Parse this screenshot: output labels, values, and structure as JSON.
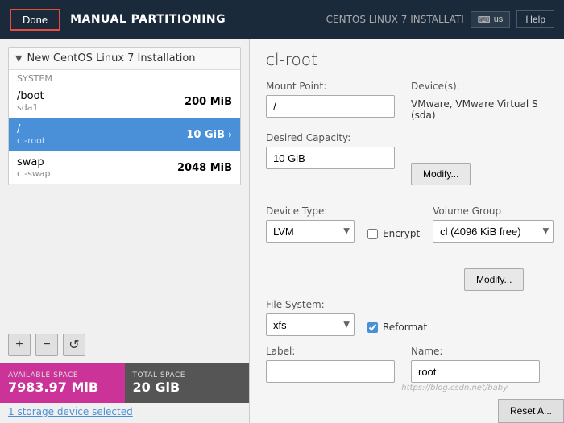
{
  "header": {
    "title": "MANUAL PARTITIONING",
    "done_label": "Done",
    "right_title": "CENTOS LINUX 7 INSTALLATI",
    "keyboard_label": "us",
    "help_label": "Help"
  },
  "left_panel": {
    "group_title": "New CentOS Linux 7 Installation",
    "system_label": "SYSTEM",
    "partitions": [
      {
        "name": "/boot",
        "device": "sda1",
        "size": "200 MiB",
        "selected": false
      },
      {
        "name": "/",
        "device": "cl-root",
        "size": "10 GiB",
        "selected": true
      },
      {
        "name": "swap",
        "device": "cl-swap",
        "size": "2048 MiB",
        "selected": false
      }
    ],
    "add_label": "+",
    "remove_label": "−",
    "refresh_label": "↺",
    "available_space_label": "AVAILABLE SPACE",
    "available_space_value": "7983.97 MiB",
    "total_space_label": "TOTAL SPACE",
    "total_space_value": "20 GiB",
    "storage_link": "1 storage device selected"
  },
  "right_panel": {
    "title": "cl-root",
    "mount_point_label": "Mount Point:",
    "mount_point_value": "/",
    "device_label": "Device(s):",
    "device_value": "VMware, VMware Virtual S (sda)",
    "desired_capacity_label": "Desired Capacity:",
    "desired_capacity_value": "10 GiB",
    "modify_top_label": "Modify...",
    "device_type_label": "Device Type:",
    "device_type_value": "LVM",
    "encrypt_label": "Encrypt",
    "volume_group_label": "Volume Group",
    "volume_group_value": "cl      (4096 KiB free)",
    "modify_bottom_label": "Modify...",
    "file_system_label": "File System:",
    "file_system_value": "xfs",
    "reformat_label": "Reformat",
    "label_label": "Label:",
    "label_value": "",
    "name_label": "Name:",
    "name_value": "root",
    "watermark": "https://blog.csdn.net/baby",
    "reset_label": "Reset A..."
  }
}
